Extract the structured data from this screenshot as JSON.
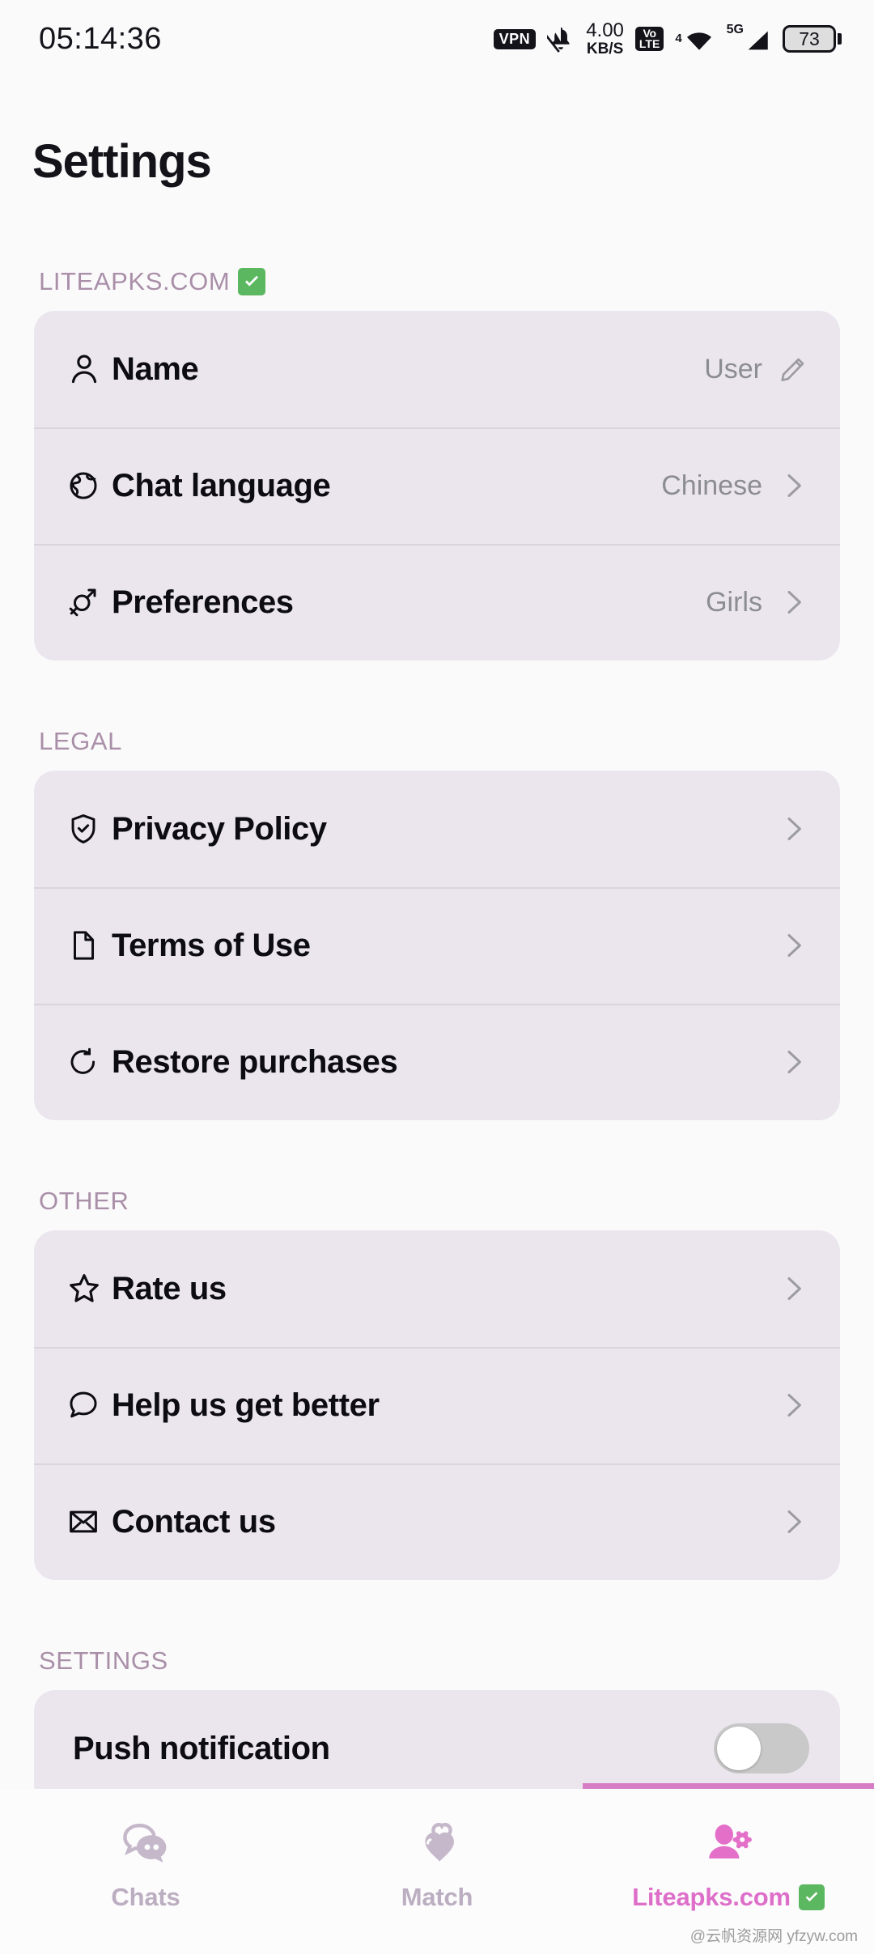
{
  "statusbar": {
    "time": "05:14:36",
    "vpn_label": "VPN",
    "mute_icon": "bell-muted-icon",
    "netspeed_value": "4.00",
    "netspeed_unit": "KB/S",
    "volte_top": "Vo",
    "volte_bottom": "LTE",
    "wifi_icon": "wifi-icon",
    "wifi_badge": "4",
    "signal_badge": "5G",
    "battery_level": "73"
  },
  "header": {
    "title": "Settings"
  },
  "sections": [
    {
      "title": "LITEAPKS.COM",
      "has_check": true,
      "rows": [
        {
          "icon": "person-icon",
          "label": "Name",
          "value": "User",
          "accessory": "pencil"
        },
        {
          "icon": "globe-icon",
          "label": "Chat language",
          "value": "Chinese",
          "accessory": "chevron"
        },
        {
          "icon": "gender-icon",
          "label": "Preferences",
          "value": "Girls",
          "accessory": "chevron"
        }
      ]
    },
    {
      "title": "LEGAL",
      "has_check": false,
      "rows": [
        {
          "icon": "shield-check-icon",
          "label": "Privacy Policy",
          "value": "",
          "accessory": "chevron"
        },
        {
          "icon": "document-icon",
          "label": "Terms of Use",
          "value": "",
          "accessory": "chevron"
        },
        {
          "icon": "restore-icon",
          "label": "Restore purchases",
          "value": "",
          "accessory": "chevron"
        }
      ]
    },
    {
      "title": "OTHER",
      "has_check": false,
      "rows": [
        {
          "icon": "star-icon",
          "label": "Rate us",
          "value": "",
          "accessory": "chevron"
        },
        {
          "icon": "chat-bubble-icon",
          "label": "Help us get better",
          "value": "",
          "accessory": "chevron"
        },
        {
          "icon": "envelope-icon",
          "label": "Contact us",
          "value": "",
          "accessory": "chevron"
        }
      ]
    },
    {
      "title": "SETTINGS",
      "has_check": false,
      "rows": [
        {
          "icon": "",
          "label": "Push notification",
          "value": "",
          "accessory": "toggle",
          "toggle_on": false
        }
      ]
    }
  ],
  "bottomnav": {
    "tabs": [
      {
        "label": "Chats",
        "icon": "chat-bubbles-icon",
        "active": false
      },
      {
        "label": "Match",
        "icon": "hearts-icon",
        "active": false
      },
      {
        "label": "Liteapks.com",
        "icon": "person-gear-icon",
        "active": true,
        "has_check": true
      }
    ]
  },
  "watermark": "@云帆资源网 yfzyw.com",
  "colors": {
    "page_bg": "#FBFAFB",
    "card_bg": "#EBE6EE",
    "section_header": "#A98FA8",
    "accent_pink": "#DD6FC9",
    "inactive_tab": "#BBAEC1",
    "value_gray": "#8C8C93",
    "check_green": "#5CB860"
  }
}
